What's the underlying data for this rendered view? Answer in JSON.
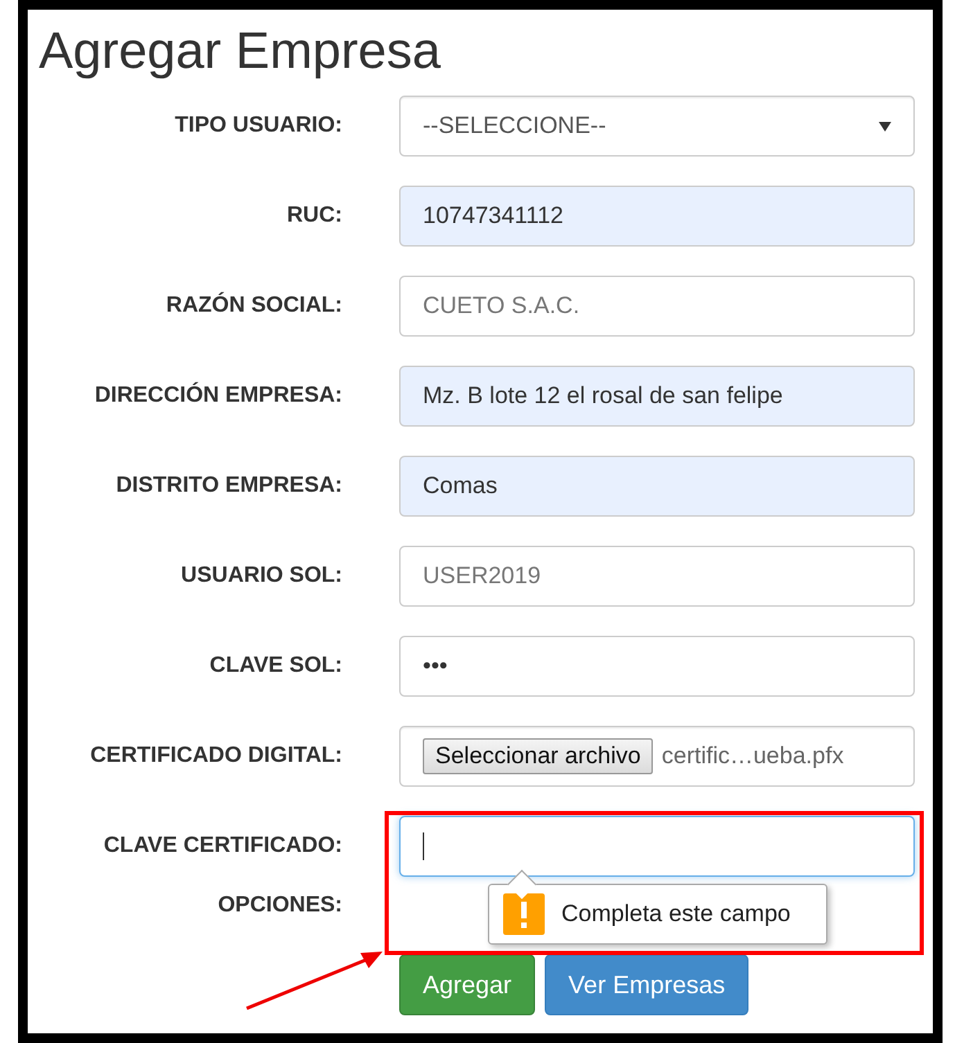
{
  "title": "Agregar Empresa",
  "fields": [
    {
      "kind": "select",
      "label": "TIPO USUARIO:",
      "value": "--SELECCIONE--",
      "autofilled": false,
      "focused": false
    },
    {
      "kind": "text",
      "label": "RUC:",
      "value": "10747341112",
      "autofilled": true,
      "focused": false
    },
    {
      "kind": "text",
      "label": "RAZÓN SOCIAL:",
      "placeholder": "CUETO S.A.C.",
      "autofilled": false,
      "focused": false
    },
    {
      "kind": "text",
      "label": "DIRECCIÓN EMPRESA:",
      "value": "Mz. B lote 12 el rosal de san felipe",
      "autofilled": true,
      "focused": false
    },
    {
      "kind": "text",
      "label": "DISTRITO EMPRESA:",
      "value": "Comas",
      "autofilled": true,
      "focused": false
    },
    {
      "kind": "text",
      "label": "USUARIO SOL:",
      "placeholder": "USER2019",
      "autofilled": false,
      "focused": false
    },
    {
      "kind": "text",
      "label": "CLAVE SOL:",
      "value": "•••",
      "autofilled": false,
      "focused": false
    },
    {
      "kind": "file",
      "label": "CERTIFICADO DIGITAL:",
      "button": "Seleccionar archivo",
      "file_name": "certific…ueba.pfx",
      "autofilled": false,
      "focused": false
    },
    {
      "kind": "text",
      "label": "CLAVE CERTIFICADO:",
      "autofilled": false,
      "focused": true,
      "tooltip": "Completa este campo"
    }
  ],
  "options": {
    "label": "OPCIONES:",
    "buttons": [
      {
        "label": "Agregar",
        "kind": "success"
      },
      {
        "label": "Ver Empresas",
        "kind": "primary"
      }
    ]
  }
}
